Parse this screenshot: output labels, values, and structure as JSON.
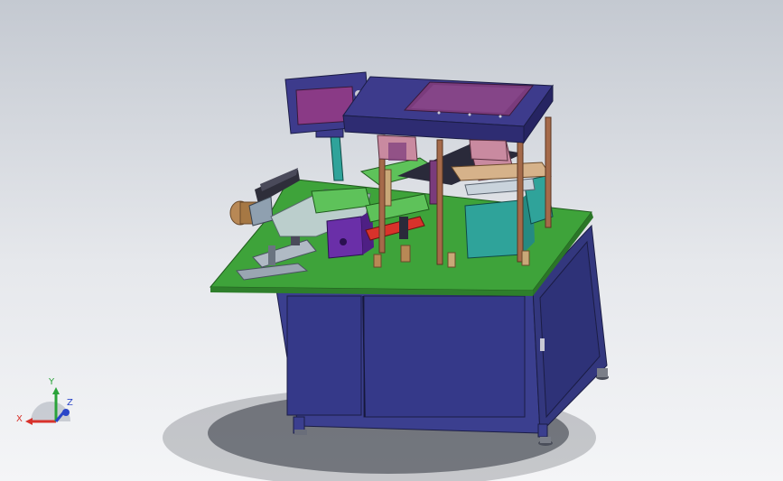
{
  "viewport": {
    "background_top": "#c4c9d1",
    "background_bottom": "#f4f5f7",
    "model_colors": {
      "cabinet": "#3b3f8f",
      "plate": "#3ea33a",
      "console_frame": "#3d3b8c",
      "screen": "#7a3b7c",
      "teal_block": "#2fa39a",
      "post": "#a56a4a",
      "red_part": "#d8322b",
      "roller": "#b88855"
    }
  },
  "triad": {
    "x_label": "X",
    "y_label": "Y",
    "z_label": "Z",
    "x_color": "#d8322b",
    "y_color": "#2aa33a",
    "z_color": "#2a45c8"
  }
}
